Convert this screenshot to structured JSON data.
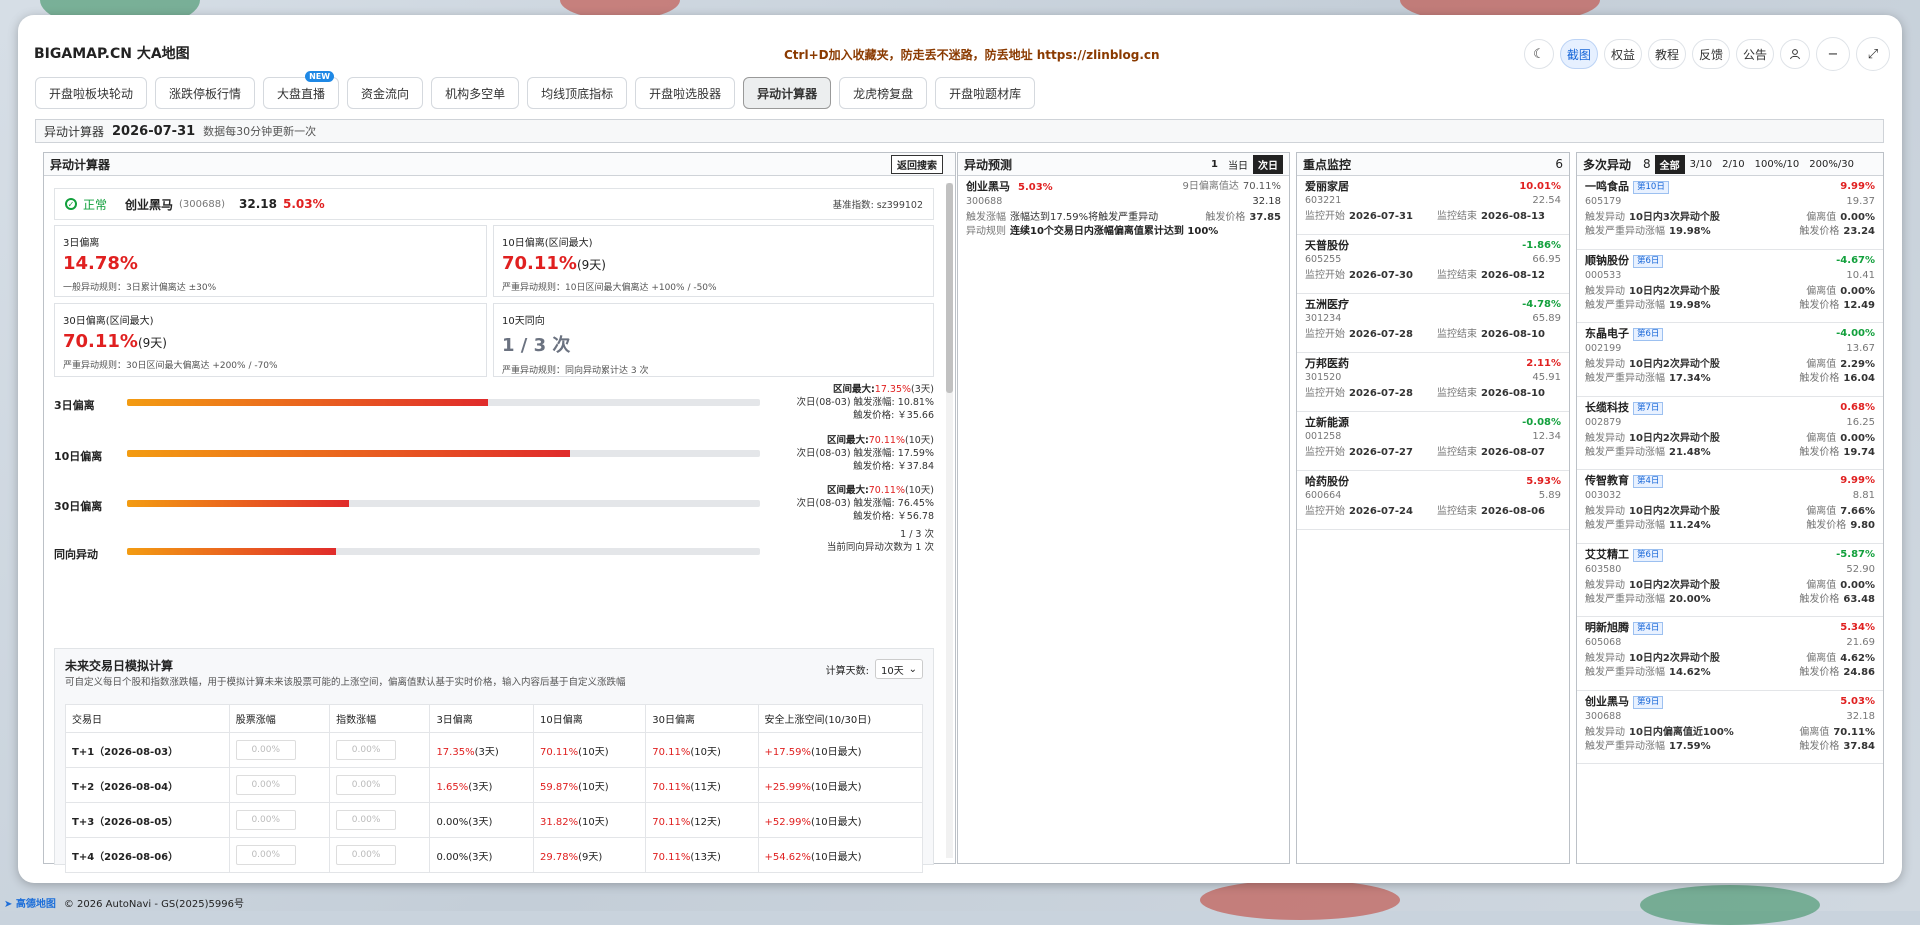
{
  "app": {
    "brand": "BIGAMAP.CN 大A地图",
    "notice": "Ctrl+D加入收藏夹，防走丢不迷路，防丢地址 https://zlinblog.cn",
    "top_buttons": [
      "截图",
      "权益",
      "教程",
      "反馈",
      "公告"
    ],
    "active_top": "截图"
  },
  "tabs": [
    {
      "label": "开盘啦板块轮动",
      "active": false
    },
    {
      "label": "涨跌停板行情",
      "active": false
    },
    {
      "label": "大盘直播",
      "active": false,
      "badge": "NEW"
    },
    {
      "label": "资金流向",
      "active": false
    },
    {
      "label": "机构多空单",
      "active": false
    },
    {
      "label": "均线顶底指标",
      "active": false
    },
    {
      "label": "开盘啦选股器",
      "active": false
    },
    {
      "label": "异动计算器",
      "active": true
    },
    {
      "label": "龙虎榜复盘",
      "active": false
    },
    {
      "label": "开盘啦题材库",
      "active": false
    }
  ],
  "subheader": {
    "title": "异动计算器",
    "date": "2026-07-31",
    "update": "数据每30分钟更新一次"
  },
  "calc": {
    "title": "异动计算器",
    "back": "返回搜索",
    "status": "正常",
    "stock_name": "创业黑马",
    "stock_code": "(300688)",
    "price": "32.18",
    "change": "5.03%",
    "benchmark": "基准指数: sz399102",
    "metrics": [
      {
        "label": "3日偏离",
        "value": "14.78%",
        "suffix": "",
        "rule": "一般异动规则：3日累计偏离达 ±30%",
        "color": "red"
      },
      {
        "label": "10日偏离(区间最大)",
        "value": "70.11%",
        "suffix": "(9天)",
        "rule": "严重异动规则：10日区间最大偏离达 +100% / -50%",
        "color": "red"
      },
      {
        "label": "30日偏离(区间最大)",
        "value": "70.11%",
        "suffix": "(9天)",
        "rule": "严重异动规则：30日区间最大偏离达 +200% / -70%",
        "color": "red"
      },
      {
        "label": "10天同向",
        "value": "1 / 3 次",
        "suffix": "",
        "rule": "严重异动规则：同向异动累计达 3 次",
        "color": "gray"
      }
    ],
    "bars": [
      {
        "label": "3日偏离",
        "fill": 0.57,
        "l1": "区间最大:",
        "l1v": "17.35%",
        "l1s": "(3天)",
        "l2": "次日(08-03) 触发涨幅: 10.81%",
        "l3": "触发价格: ￥35.66"
      },
      {
        "label": "10日偏离",
        "fill": 0.7,
        "l1": "区间最大:",
        "l1v": "70.11%",
        "l1s": "(10天)",
        "l2": "次日(08-03) 触发涨幅: 17.59%",
        "l3": "触发价格: ￥37.84"
      },
      {
        "label": "30日偏离",
        "fill": 0.35,
        "l1": "区间最大:",
        "l1v": "70.11%",
        "l1s": "(10天)",
        "l2": "次日(08-03) 触发涨幅: 76.45%",
        "l3": "触发价格: ￥56.78"
      },
      {
        "label": "同向异动",
        "fill": 0.33,
        "l1": "",
        "l1v": "",
        "l1s": "",
        "l2": "1 / 3 次",
        "l3": "当前同向异动次数为 1 次"
      }
    ],
    "sim": {
      "title": "未来交易日模拟计算",
      "desc": "可自定义每日个股和指数涨跌幅，用于模拟计算未来该股票可能的上涨空间，偏离值默认基于实时价格，输入内容后基于自定义涨跌幅",
      "days_label": "计算天数:",
      "days_value": "10天",
      "headers": [
        "交易日",
        "股票涨幅",
        "指数涨幅",
        "3日偏离",
        "10日偏离",
        "30日偏离",
        "安全上涨空间(10/30日)"
      ],
      "input_placeholder": "0.00%",
      "rows": [
        {
          "day": "T+1（2026-08-03）",
          "d3": "17.35%",
          "d3s": "(3天)",
          "d3c": "red",
          "d10": "70.11%",
          "d10s": "(10天)",
          "d30": "70.11%",
          "d30s": "(10天)",
          "safe": "+17.59%",
          "safes": "(10日最大)"
        },
        {
          "day": "T+2（2026-08-04）",
          "d3": "1.65%",
          "d3s": "(3天)",
          "d3c": "red",
          "d10": "59.87%",
          "d10s": "(10天)",
          "d30": "70.11%",
          "d30s": "(11天)",
          "safe": "+25.99%",
          "safes": "(10日最大)"
        },
        {
          "day": "T+3（2026-08-05）",
          "d3": "0.00%",
          "d3s": "(3天)",
          "d3c": "plain",
          "d10": "31.82%",
          "d10s": "(10天)",
          "d30": "70.11%",
          "d30s": "(12天)",
          "safe": "+52.99%",
          "safes": "(10日最大)"
        },
        {
          "day": "T+4（2026-08-06）",
          "d3": "0.00%",
          "d3s": "(3天)",
          "d3c": "plain",
          "d10": "29.78%",
          "d10s": "(9天)",
          "d30": "70.11%",
          "d30s": "(13天)",
          "safe": "+54.62%",
          "safes": "(10日最大)"
        }
      ]
    }
  },
  "predict": {
    "title": "异动预测",
    "count": "1",
    "seg": [
      "当日",
      "次日"
    ],
    "seg_active": "次日",
    "items": [
      {
        "name": "创业黑马",
        "change": "5.03%",
        "code": "300688",
        "dev_label": "9日偏离值达",
        "dev": "70.11%",
        "price": "32.18",
        "trig_label": "触发涨幅",
        "trig_text": "涨幅达到17.59%将触发严重异动",
        "trig_price_label": "触发价格",
        "trig_price": "37.85",
        "reason_label": "异动规则",
        "reason": "连续10个交易日内涨幅偏离值累计达到 100%"
      }
    ]
  },
  "watch": {
    "title": "重点监控",
    "count": "6",
    "start_label": "监控开始",
    "end_label": "监控结束",
    "items": [
      {
        "name": "爱丽家居",
        "code": "603221",
        "change": "10.01%",
        "dir": "up",
        "price": "22.54",
        "start": "2026-07-31",
        "end": "2026-08-13"
      },
      {
        "name": "天普股份",
        "code": "605255",
        "change": "-1.86%",
        "dir": "down",
        "price": "66.95",
        "start": "2026-07-30",
        "end": "2026-08-12"
      },
      {
        "name": "五洲医疗",
        "code": "301234",
        "change": "-4.78%",
        "dir": "down",
        "price": "65.89",
        "start": "2026-07-28",
        "end": "2026-08-10"
      },
      {
        "name": "万邦医药",
        "code": "301520",
        "change": "2.11%",
        "dir": "up",
        "price": "45.91",
        "start": "2026-07-28",
        "end": "2026-08-10"
      },
      {
        "name": "立新能源",
        "code": "001258",
        "change": "-0.08%",
        "dir": "down",
        "price": "12.34",
        "start": "2026-07-27",
        "end": "2026-08-07"
      },
      {
        "name": "哈药股份",
        "code": "600664",
        "change": "5.93%",
        "dir": "up",
        "price": "5.89",
        "start": "2026-07-24",
        "end": "2026-08-06"
      }
    ]
  },
  "multi": {
    "title": "多次异动",
    "count": "8",
    "filters": [
      "全部",
      "3/10",
      "2/10",
      "100%/10",
      "200%/30"
    ],
    "filter_active": "全部",
    "lbl_abn": "触发异动",
    "lbl_dev": "偏离值",
    "lbl_sev": "触发严重异动涨幅",
    "lbl_price": "触发价格",
    "items": [
      {
        "name": "一鸣食品",
        "badge": "第10日",
        "code": "605179",
        "change": "9.99%",
        "dir": "up",
        "price": "19.37",
        "abn": "10日内3次异动个股",
        "dev": "0.00%",
        "sev": "19.98%",
        "tprice": "23.24"
      },
      {
        "name": "顺钠股份",
        "badge": "第6日",
        "code": "000533",
        "change": "-4.67%",
        "dir": "down",
        "price": "10.41",
        "abn": "10日内2次异动个股",
        "dev": "0.00%",
        "sev": "19.98%",
        "tprice": "12.49"
      },
      {
        "name": "东晶电子",
        "badge": "第6日",
        "code": "002199",
        "change": "-4.00%",
        "dir": "down",
        "price": "13.67",
        "abn": "10日内2次异动个股",
        "dev": "2.29%",
        "sev": "17.34%",
        "tprice": "16.04"
      },
      {
        "name": "长缆科技",
        "badge": "第7日",
        "code": "002879",
        "change": "0.68%",
        "dir": "up",
        "price": "16.25",
        "abn": "10日内2次异动个股",
        "dev": "0.00%",
        "sev": "21.48%",
        "tprice": "19.74"
      },
      {
        "name": "传智教育",
        "badge": "第4日",
        "code": "003032",
        "change": "9.99%",
        "dir": "up",
        "price": "8.81",
        "abn": "10日内2次异动个股",
        "dev": "7.66%",
        "sev": "11.24%",
        "tprice": "9.80"
      },
      {
        "name": "艾艾精工",
        "badge": "第6日",
        "code": "603580",
        "change": "-5.87%",
        "dir": "down",
        "price": "52.90",
        "abn": "10日内2次异动个股",
        "dev": "0.00%",
        "sev": "20.00%",
        "tprice": "63.48"
      },
      {
        "name": "明新旭腾",
        "badge": "第4日",
        "code": "605068",
        "change": "5.34%",
        "dir": "up",
        "price": "21.69",
        "abn": "10日内2次异动个股",
        "dev": "4.62%",
        "sev": "14.62%",
        "tprice": "24.86"
      },
      {
        "name": "创业黑马",
        "badge": "第9日",
        "code": "300688",
        "change": "5.03%",
        "dir": "up",
        "price": "32.18",
        "abn": "10日内偏离值近100%",
        "dev": "70.11%",
        "sev": "17.59%",
        "tprice": "37.84"
      }
    ]
  },
  "footer": {
    "logo": "高德地图",
    "copy": "© 2026 AutoNavi - GS(2025)5996号"
  }
}
